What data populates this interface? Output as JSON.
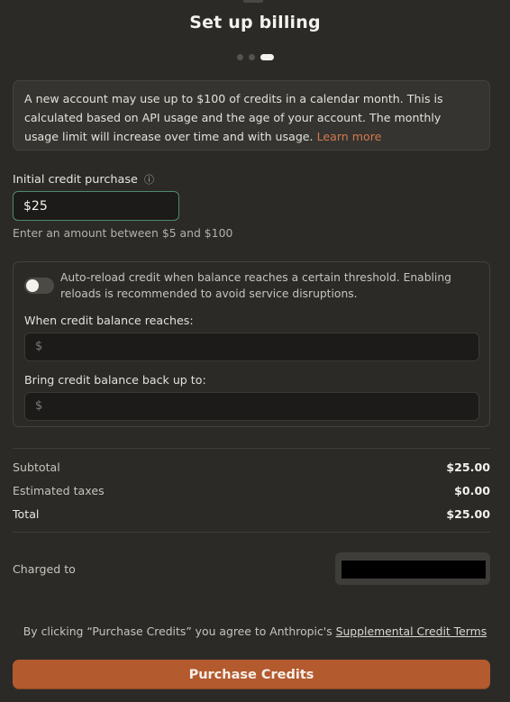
{
  "dialog": {
    "title": "Set up billing",
    "steps": {
      "total": 3,
      "current": 3
    }
  },
  "notice": {
    "text": "A new account may use up to $100 of credits in a calendar month. This is calculated based on API usage and the age of your account. The monthly usage limit will increase over time and with usage.",
    "link_label": "Learn more"
  },
  "credit_purchase": {
    "label": "Initial credit purchase",
    "info_icon": "info-circle-icon",
    "value": "$25",
    "hint": "Enter an amount between $5 and $100"
  },
  "auto_reload": {
    "enabled": false,
    "description": "Auto-reload credit when balance reaches a certain threshold. Enabling reloads is recommended to avoid service disruptions.",
    "threshold_label": "When credit balance reaches:",
    "threshold_prefix": "$",
    "threshold_value": "",
    "refill_label": "Bring credit balance back up to:",
    "refill_prefix": "$",
    "refill_value": ""
  },
  "summary": {
    "subtotal_label": "Subtotal",
    "subtotal_value": "$25.00",
    "taxes_label": "Estimated taxes",
    "taxes_value": "$0.00",
    "total_label": "Total",
    "total_value": "$25.00"
  },
  "payment": {
    "charged_to_label": "Charged to"
  },
  "terms": {
    "prefix": "By clicking “Purchase Credits” you agree to Anthropic's ",
    "link_label": "Supplemental Credit Terms"
  },
  "actions": {
    "purchase_label": "Purchase Credits"
  },
  "colors": {
    "background": "#2b2a27",
    "accent": "#b35a2f",
    "link": "#d1784f",
    "focus_border": "#4e8a6a"
  }
}
